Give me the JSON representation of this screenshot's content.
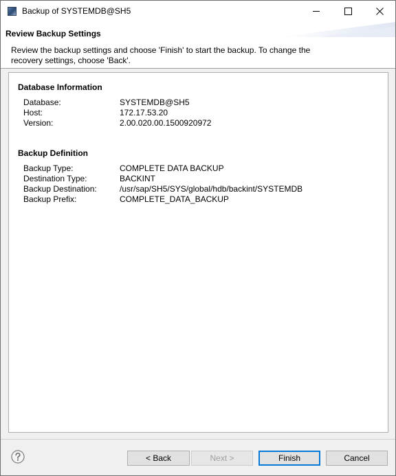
{
  "window": {
    "title": "Backup of SYSTEMDB@SH5"
  },
  "wizard": {
    "title": "Review Backup Settings",
    "message": "Review the backup settings and choose 'Finish' to start the backup. To change the recovery settings, choose 'Back'."
  },
  "database_info": {
    "heading": "Database Information",
    "rows": [
      {
        "label": "Database:",
        "value": "SYSTEMDB@SH5"
      },
      {
        "label": "Host:",
        "value": "172.17.53.20"
      },
      {
        "label": "Version:",
        "value": "2.00.020.00.1500920972"
      }
    ]
  },
  "backup_definition": {
    "heading": "Backup Definition",
    "rows": [
      {
        "label": "Backup Type:",
        "value": "COMPLETE DATA BACKUP"
      },
      {
        "label": "Destination Type:",
        "value": "BACKINT"
      },
      {
        "label": "Backup Destination:",
        "value": "/usr/sap/SH5/SYS/global/hdb/backint/SYSTEMDB"
      },
      {
        "label": "Backup Prefix:",
        "value": "COMPLETE_DATA_BACKUP"
      }
    ]
  },
  "buttons": {
    "back": "< Back",
    "next": "Next >",
    "finish": "Finish",
    "cancel": "Cancel"
  },
  "icons": {
    "app": "sap-hana-studio-icon",
    "help": "help-icon",
    "minimize": "minimize-icon",
    "maximize": "maximize-icon",
    "close": "close-icon"
  },
  "colors": {
    "default_button_border": "#0078d7",
    "disabled_text": "#a0a0a0"
  }
}
